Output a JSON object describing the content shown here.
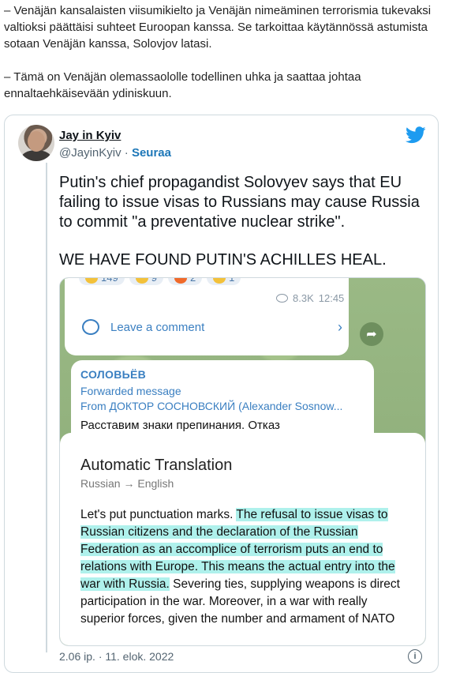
{
  "article": {
    "paragraph_1": "– Venäjän kansalaisten viisumikielto ja Venäjän nimeäminen terrorismia tukevaksi valtioksi päättäisi suhteet Euroopan kanssa. Se tarkoittaa käytännössä astumista sotaan Venäjän kanssa, Solovjov latasi.",
    "paragraph_2": "– Tämä on Venäjän olemassaololle todellinen uhka ja saattaa johtaa ennaltaehkäisevään ydiniskuun."
  },
  "tweet": {
    "author_name": "Jay in Kyiv",
    "handle": "@JayinKyiv",
    "separator": " · ",
    "follow_label": "Seuraa",
    "text_1": "Putin's chief propagandist Solovyev says that EU failing to issue visas to Russians may cause Russia to commit \"a preventative nuclear strike\".",
    "text_2": "WE HAVE FOUND PUTIN'S ACHILLES HEAL.",
    "timestamp": "2.06 ip. · 11. elok. 2022",
    "info_glyph": "i",
    "colors": {
      "twitter_blue": "#1d9bf0",
      "link_blue": "#1d77b8",
      "highlight": "#6ee6dc"
    }
  },
  "telegram": {
    "reactions": [
      {
        "emoji": "thumbs-up",
        "count": "149"
      },
      {
        "emoji": "thumbs-down",
        "count": "9"
      },
      {
        "emoji": "fire",
        "count": "2"
      },
      {
        "emoji": "clap",
        "count": "1"
      }
    ],
    "views": "8.3K",
    "time": "12:45",
    "comment_label": "Leave a comment",
    "chevron_glyph": "›",
    "share_glyph": "➦",
    "sender": "СОЛОВЬЁВ",
    "forwarded_label": "Forwarded message",
    "from_line": "From ДОКТОР СОСНОВСКИЙ (Alexander Sosnow...",
    "message_preview": "Расставим знаки препинания. Отказ"
  },
  "translation": {
    "title": "Automatic Translation",
    "languages": "Russian → English",
    "body_plain_1": "Let's put punctuation marks. ",
    "body_highlight": "The refusal to issue visas to Russian citizens and the declaration of the Russian Federation as an accomplice of terrorism puts an end to relations with Europe. This means the actual entry into the war with Russia.",
    "body_plain_2": " Severing ties, supplying weapons is direct participation in the war. Moreover, in a war with really superior forces, given the number and armament of NATO"
  }
}
